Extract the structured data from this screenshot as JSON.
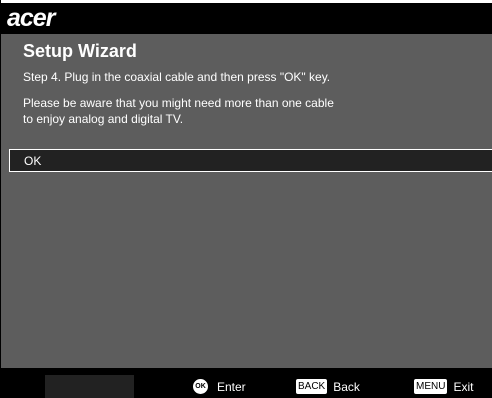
{
  "brand": {
    "logo_text": "acer"
  },
  "wizard": {
    "title": "Setup Wizard",
    "step": "Step 4. Plug in the coaxial cable and then press \"OK\" key.",
    "note_line1": "Please be aware that you might need more than one cable",
    "note_line2": "to enjoy analog and digital TV.",
    "ok_option": "OK"
  },
  "footer": {
    "enter_key": "OK",
    "enter_label": "Enter",
    "back_key": "BACK",
    "back_label": "Back",
    "menu_key": "MENU",
    "exit_label": "Exit"
  },
  "colors": {
    "background": "#5d5d5d",
    "header": "#000000",
    "selection": "#222222",
    "text": "#ffffff"
  }
}
